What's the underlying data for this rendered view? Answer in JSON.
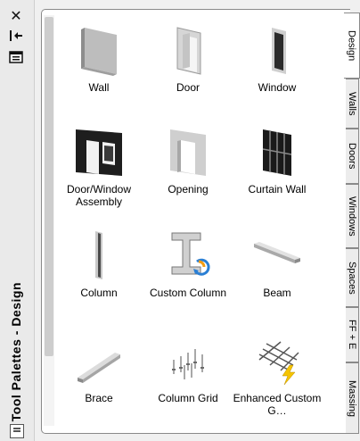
{
  "palette": {
    "title": "Tool Palettes - Design"
  },
  "strip_icons": [
    "close-icon",
    "auto-hide-icon",
    "properties-icon",
    "palette-menu-icon"
  ],
  "tools": [
    {
      "label": "Wall",
      "icon": "wall-icon"
    },
    {
      "label": "Door",
      "icon": "door-icon"
    },
    {
      "label": "Window",
      "icon": "window-icon"
    },
    {
      "label": "Door/Window Assembly",
      "icon": "door-window-assembly-icon"
    },
    {
      "label": "Opening",
      "icon": "opening-icon"
    },
    {
      "label": "Curtain Wall",
      "icon": "curtain-wall-icon"
    },
    {
      "label": "Column",
      "icon": "column-icon"
    },
    {
      "label": "Custom Column",
      "icon": "custom-column-icon"
    },
    {
      "label": "Beam",
      "icon": "beam-icon"
    },
    {
      "label": "Brace",
      "icon": "brace-icon"
    },
    {
      "label": "Column Grid",
      "icon": "column-grid-icon"
    },
    {
      "label": "Enhanced Custom G…",
      "icon": "enhanced-custom-grid-icon"
    }
  ],
  "tabs": [
    {
      "label": "Design",
      "active": true
    },
    {
      "label": "Walls",
      "active": false
    },
    {
      "label": "Doors",
      "active": false
    },
    {
      "label": "Windows",
      "active": false
    },
    {
      "label": "Spaces",
      "active": false
    },
    {
      "label": "FF + E",
      "active": false
    },
    {
      "label": "Massing",
      "active": false
    }
  ],
  "colors": {
    "panel_bg": "#ffffff",
    "strip_bg": "#eaeaea",
    "tab_bg": "#ececec",
    "accent_orange": "#f39c12",
    "accent_blue": "#2a7fd4"
  }
}
